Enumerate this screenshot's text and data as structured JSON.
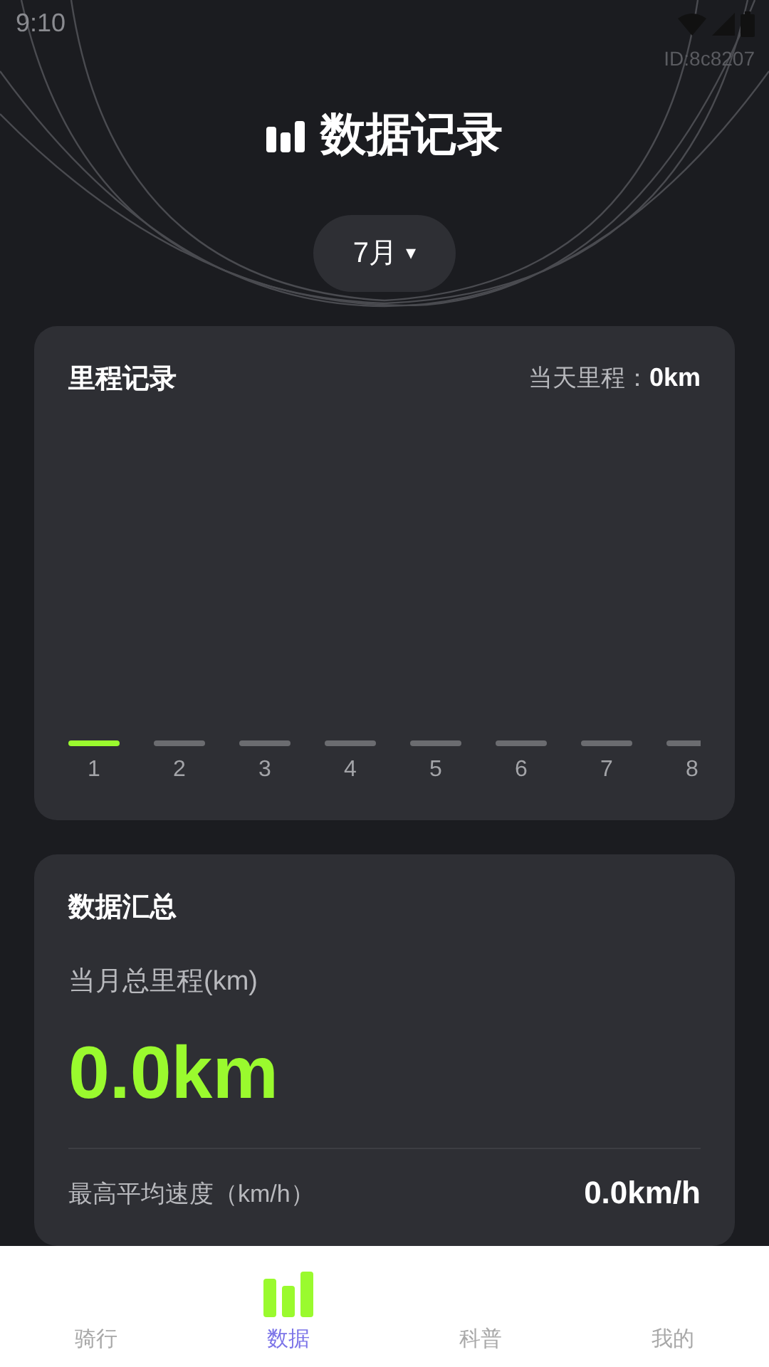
{
  "status_bar": {
    "time": "9:10"
  },
  "device_id": "ID:8c8207",
  "title": "数据记录",
  "month_picker": {
    "label": "7月",
    "caret": "▾"
  },
  "mileage_card": {
    "title": "里程记录",
    "today_label": "当天里程：",
    "today_value": "0km",
    "days": [
      {
        "label": "1",
        "selected": true
      },
      {
        "label": "2",
        "selected": false
      },
      {
        "label": "3",
        "selected": false
      },
      {
        "label": "4",
        "selected": false
      },
      {
        "label": "5",
        "selected": false
      },
      {
        "label": "6",
        "selected": false
      },
      {
        "label": "7",
        "selected": false
      },
      {
        "label": "8",
        "selected": false
      }
    ]
  },
  "summary_card": {
    "title": "数据汇总",
    "month_total_label": "当月总里程(km)",
    "month_total_value": "0.0km",
    "max_speed_label": "最高平均速度（km/h）",
    "max_speed_value": "0.0km/h"
  },
  "bottom_nav": [
    {
      "label": "骑行",
      "selected": false
    },
    {
      "label": "数据",
      "selected": true
    },
    {
      "label": "科普",
      "selected": false
    },
    {
      "label": "我的",
      "selected": false
    }
  ]
}
